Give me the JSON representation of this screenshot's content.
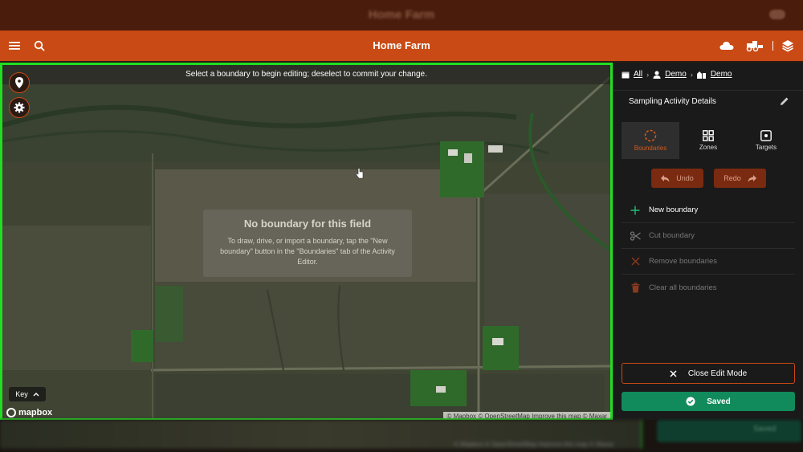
{
  "backdrop": {
    "title": "Home Farm",
    "bottom_attribution": "© Mapbox © OpenStreetMap Improve this map © Maxar",
    "bottom_saved": "Saved"
  },
  "header": {
    "title": "Home Farm",
    "icons": [
      "menu-icon",
      "search-icon",
      "cloud-icon",
      "tractor-icon",
      "layers-icon"
    ]
  },
  "map": {
    "banner": "Select a boundary to begin editing; deselect to commit your change.",
    "no_boundary": {
      "title": "No boundary for this field",
      "body": "To draw, drive, or import a boundary, tap the \"New boundary\" button in the \"Boundaries\" tab of the Activity Editor."
    },
    "key_label": "Key",
    "logo": "mapbox",
    "attribution": "© Mapbox © OpenStreetMap Improve this map © Maxar",
    "highlight_color": "#22dd22"
  },
  "panel": {
    "breadcrumb": {
      "all": "All",
      "org": "Demo",
      "farm": "Demo"
    },
    "details_title": "Sampling Activity Details",
    "tabs": [
      {
        "label": "Boundaries",
        "icon": "boundary-dashed-icon",
        "active": true
      },
      {
        "label": "Zones",
        "icon": "grid-icon",
        "active": false
      },
      {
        "label": "Targets",
        "icon": "target-icon",
        "active": false
      }
    ],
    "undo_label": "Undo",
    "redo_label": "Redo",
    "actions": [
      {
        "label": "New boundary",
        "icon": "plus-icon",
        "enabled": true
      },
      {
        "label": "Cut boundary",
        "icon": "scissors-icon",
        "enabled": false
      },
      {
        "label": "Remove boundaries",
        "icon": "x-icon",
        "enabled": false
      },
      {
        "label": "Clear all boundaries",
        "icon": "trash-icon",
        "enabled": false
      }
    ],
    "close_edit_label": "Close Edit Mode",
    "saved_label": "Saved",
    "accent_color": "#c94a14",
    "saved_color": "#118a5c"
  }
}
